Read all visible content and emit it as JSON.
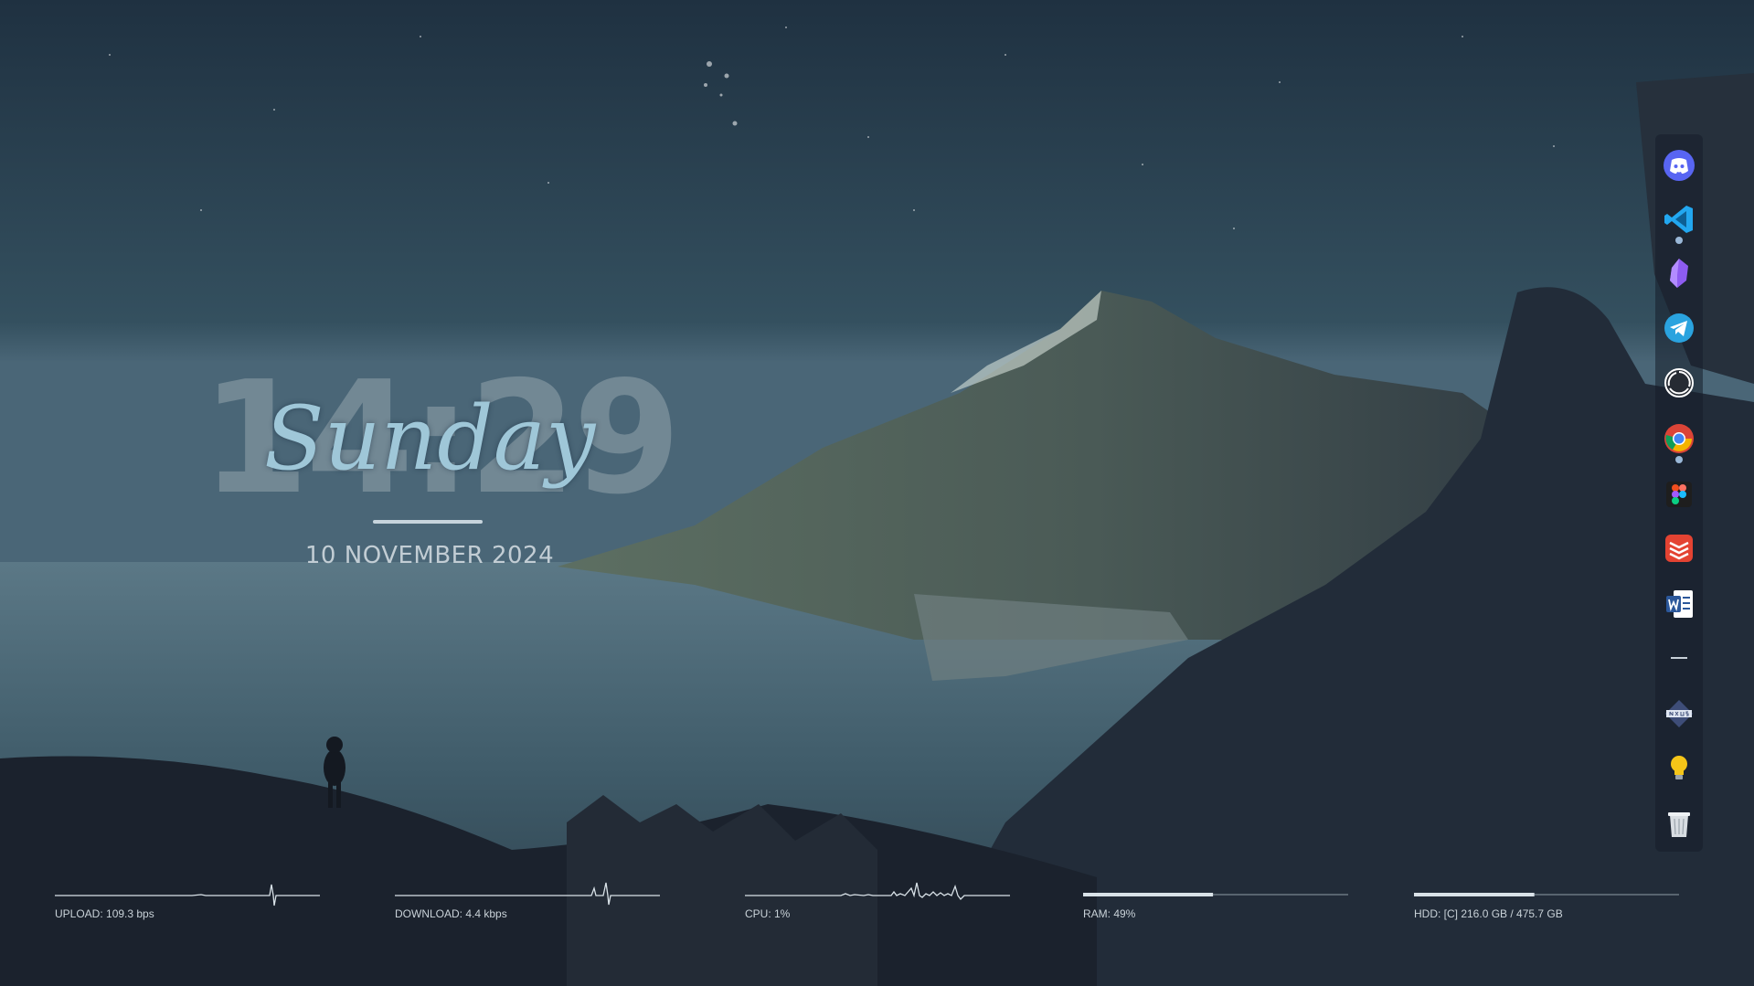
{
  "clock": {
    "time": "14:29",
    "day": "Sunday",
    "date": "10 NOVEMBER 2024"
  },
  "dock": {
    "items": [
      {
        "icon": "discord-icon",
        "color": "#5865f2",
        "running": false
      },
      {
        "icon": "vscode-icon",
        "color": "#22a7f0",
        "running": true
      },
      {
        "icon": "obsidian-icon",
        "color": "#8e5cf0",
        "running": false
      },
      {
        "icon": "telegram-icon",
        "color": "#2aa3df",
        "running": false
      },
      {
        "icon": "obs-studio-icon",
        "color": "#ffffff",
        "running": false
      },
      {
        "icon": "chrome-icon",
        "color": "#4285f4",
        "running": true
      },
      {
        "icon": "figma-icon",
        "color": "#f24e1e",
        "running": false
      },
      {
        "icon": "todoist-icon",
        "color": "#e44332",
        "running": false
      },
      {
        "icon": "word-icon",
        "color": "#2b579a",
        "running": false
      },
      {
        "icon": "separator-icon",
        "color": "#c8d0d8",
        "running": false
      },
      {
        "icon": "nexus-icon",
        "color": "#5a6fa0",
        "running": false
      },
      {
        "icon": "lightbulb-icon",
        "color": "#f5c518",
        "running": false
      },
      {
        "icon": "recycle-bin-icon",
        "color": "#d8dde2",
        "running": false
      }
    ]
  },
  "stats": {
    "upload": {
      "label": "UPLOAD: 109.3 bps"
    },
    "download": {
      "label": "DOWNLOAD: 4.4 kbps"
    },
    "cpu": {
      "label": "CPU: 1%",
      "percent": 1
    },
    "ram": {
      "label": "RAM: 49%",
      "percent": 49
    },
    "hdd": {
      "label": "HDD: [C] 216.0 GB / 475.7 GB",
      "used_gb": 216.0,
      "total_gb": 475.7
    }
  },
  "colors": {
    "accent_line": "#c7d4dc",
    "graph_line": "#d9e2e8",
    "graph_track": "#7d8a94"
  }
}
